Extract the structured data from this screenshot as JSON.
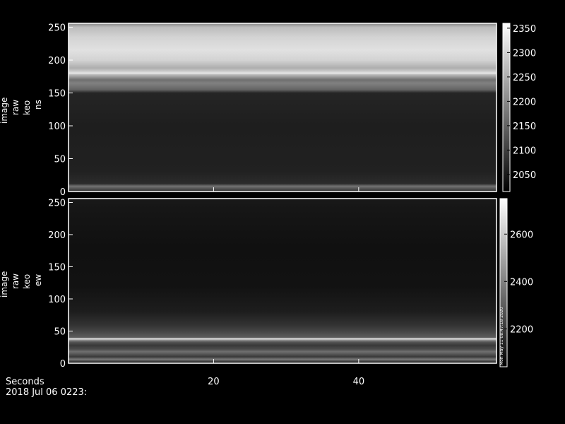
{
  "chart_data": [
    {
      "type": "heatmap",
      "ylabel": [
        "image",
        "raw",
        "keo",
        "ns"
      ],
      "xlim": [
        0,
        59
      ],
      "ylim": [
        0,
        256
      ],
      "yticks": [
        0,
        50,
        100,
        150,
        200,
        250
      ],
      "xticks": [
        20,
        40
      ],
      "colorbar": {
        "range": [
          2015,
          2360
        ],
        "ticks": [
          2050,
          2100,
          2150,
          2200,
          2250,
          2300,
          2350
        ]
      },
      "row_profile": {
        "rows": [
          0,
          8,
          12,
          30,
          100,
          150,
          155,
          165,
          170,
          178,
          180,
          183,
          188,
          200,
          215,
          235,
          250,
          256
        ],
        "values": [
          2080,
          2170,
          2075,
          2060,
          2055,
          2065,
          2150,
          2190,
          2165,
          2270,
          2330,
          2290,
          2250,
          2300,
          2320,
          2300,
          2270,
          2200
        ]
      },
      "colormap": "grayscale"
    },
    {
      "type": "heatmap",
      "ylabel": [
        "image",
        "raw",
        "keo",
        "ew"
      ],
      "xlim": [
        0,
        59
      ],
      "ylim": [
        0,
        256
      ],
      "yticks": [
        0,
        50,
        100,
        150,
        200,
        250
      ],
      "xticks": [
        20,
        40
      ],
      "colorbar": {
        "range": [
          2040,
          2750
        ],
        "ticks": [
          2200,
          2400,
          2600
        ]
      },
      "row_profile": {
        "rows": [
          0,
          3,
          6,
          10,
          18,
          22,
          28,
          33,
          36,
          38,
          40,
          50,
          60,
          80,
          120,
          180,
          240,
          256
        ],
        "values": [
          2080,
          2220,
          2380,
          2200,
          2350,
          2250,
          2200,
          2280,
          2450,
          2700,
          2300,
          2230,
          2180,
          2120,
          2090,
          2085,
          2100,
          2110
        ]
      },
      "colormap": "grayscale",
      "colorbar_annotation": "Mon May 11 08:47:18 2020"
    }
  ],
  "footer": {
    "xlabel": "Seconds",
    "date": "2018 Jul 06 0223:"
  }
}
